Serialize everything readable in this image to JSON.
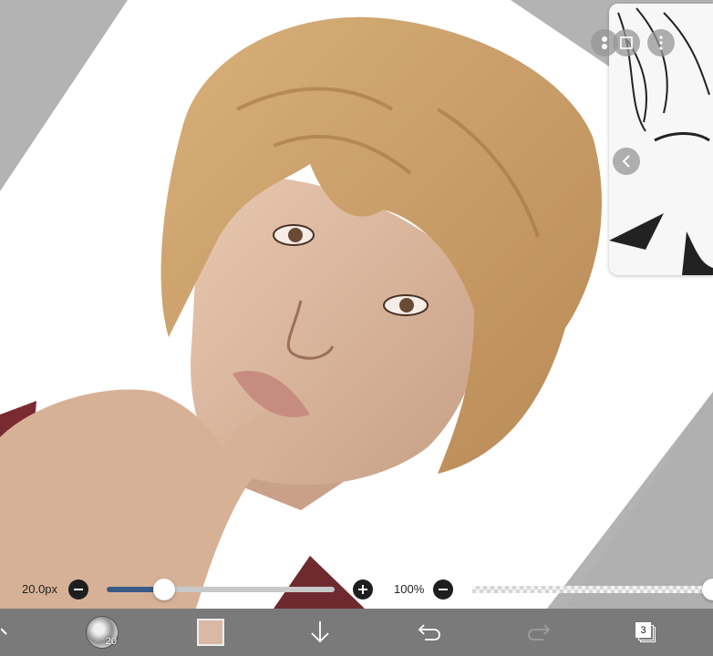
{
  "slider_bar": {
    "brush_size_value": "20.0px",
    "brush_size_level": 0.25,
    "opacity_value": "100%",
    "opacity_level": 1.0
  },
  "toolbar": {
    "brush_number": "20",
    "current_color": "#d9b8a4",
    "layer_count": "3"
  },
  "colors": {
    "toolbar_bg": "#7a7a7a",
    "slider_fill": "#3a5a86",
    "canvas_bg": "#ffffff",
    "outside_canvas": "#b3b3b3"
  },
  "icons": [
    "transform-icon",
    "brush-icon",
    "color-swatch",
    "download-icon",
    "undo-icon",
    "redo-icon",
    "layers-icon",
    "minus-icon",
    "plus-icon",
    "reference-layers-icon",
    "window-icon",
    "more-icon",
    "chevron-left-icon"
  ]
}
